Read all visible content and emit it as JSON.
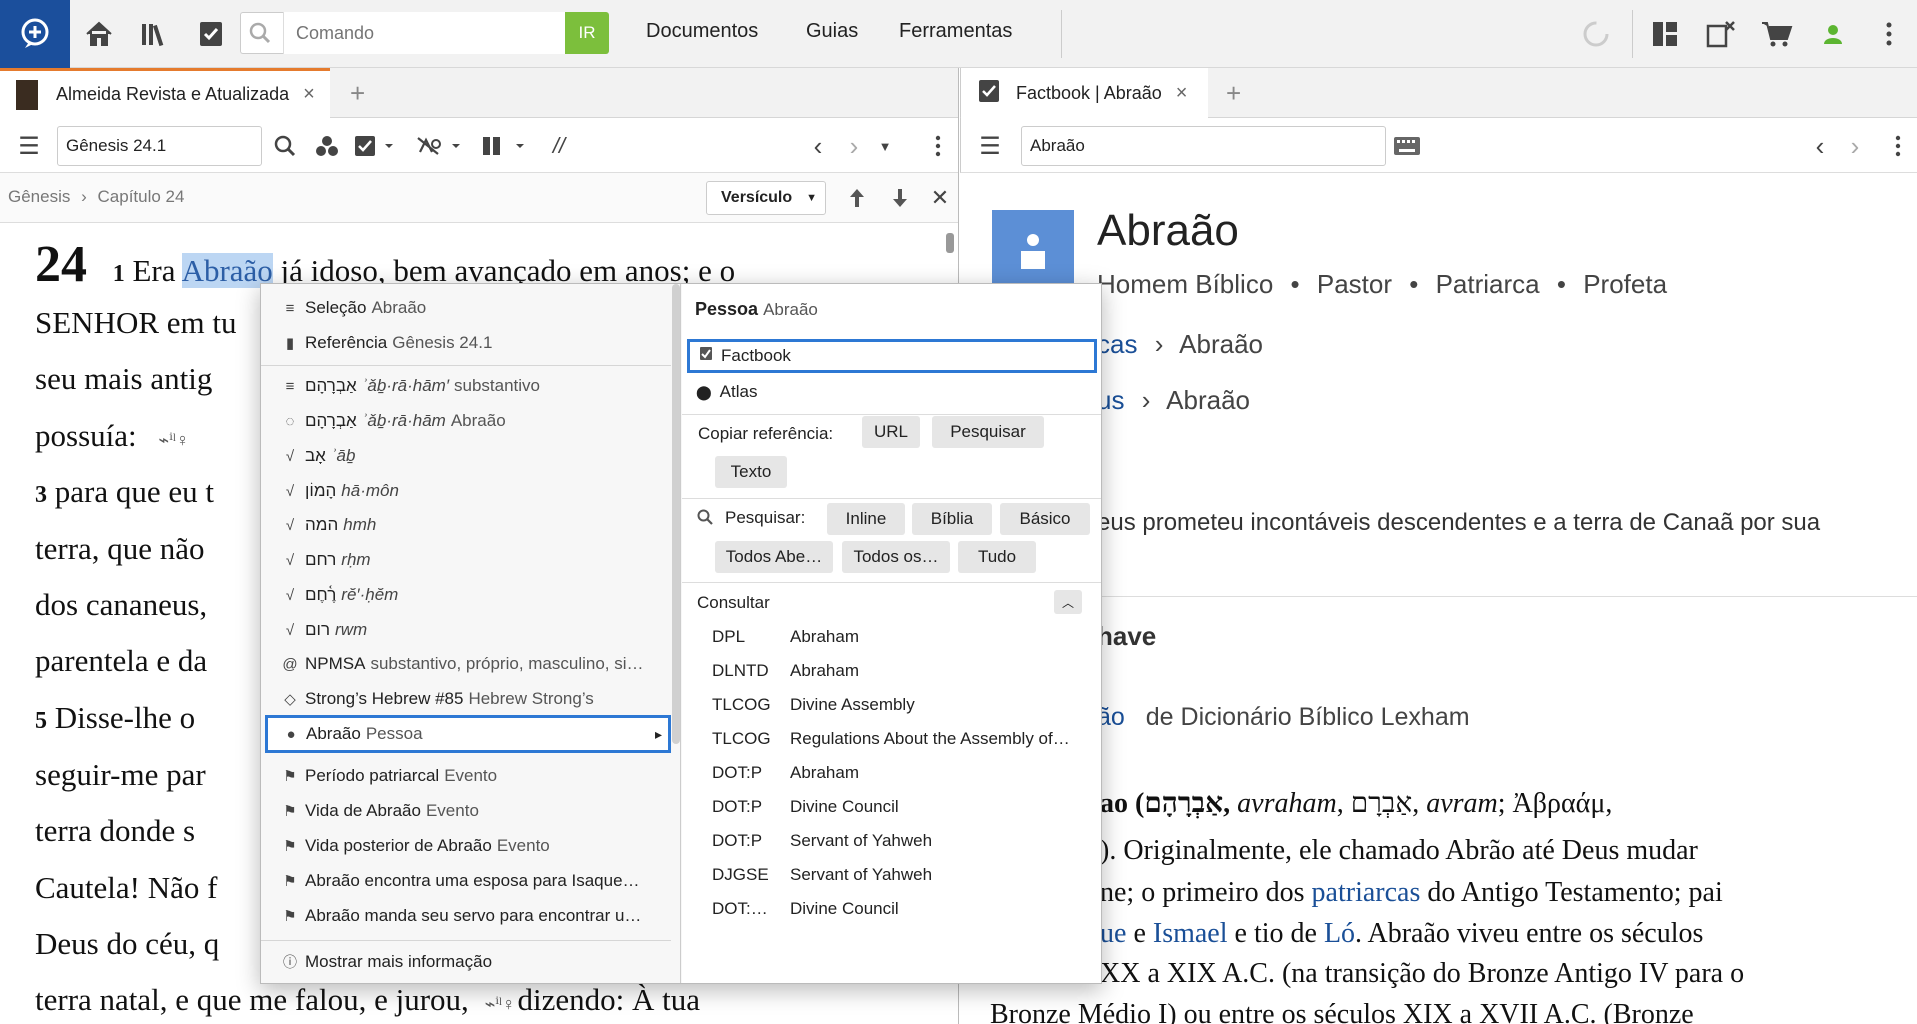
{
  "toolbar": {
    "command_placeholder": "Comando",
    "go_label": "IR",
    "menus": [
      "Documentos",
      "Guias",
      "Ferramentas"
    ]
  },
  "left_tab": {
    "title": "Almeida Revista e Atualizada",
    "close": "×",
    "add": "+"
  },
  "right_tab": {
    "title": "Factbook | Abraão",
    "close": "×",
    "add": "+"
  },
  "left_panel": {
    "reference": "Gênesis 24.1",
    "breadcrumb": [
      "Gênesis",
      "›",
      "Capítulo 24"
    ],
    "versiculo": "Versículo",
    "parallel": "//",
    "chapter": "24",
    "lines": [
      {
        "vnum": "1",
        "pre": " Era ",
        "hl": "Abraão",
        "post": " já idoso, bem avançado em anos; e o"
      },
      {
        "text": "SENHOR em tu"
      },
      {
        "text": "seu mais antig"
      },
      {
        "text": "possuía:"
      },
      {
        "vnum": "3",
        "text": " para que eu t"
      },
      {
        "text": "terra, que não"
      },
      {
        "text": "dos cananeus,"
      },
      {
        "text": "parentela e da"
      },
      {
        "vnum": "5",
        "text": " Disse-lhe o"
      },
      {
        "text": "seguir-me par"
      },
      {
        "text": "terra donde s"
      },
      {
        "text": "Cautela! Não f"
      },
      {
        "text": "Deus do céu, q"
      },
      {
        "text": "terra natal, e que me falou, e jurou,",
        "post": "dizendo: À tua"
      }
    ]
  },
  "right_panel": {
    "search": "Abraão",
    "title": "Abraão",
    "roles": [
      "Homem Bíblico",
      "•",
      "Pastor",
      "•",
      "Patriarca",
      "•",
      "Profeta"
    ],
    "crumb1": {
      "link": "cas",
      "sep": "›",
      "name": "Abraão"
    },
    "crumb2": {
      "link": "us",
      "sep": "›",
      "name": "Abraão"
    },
    "summary": "eus prometeu incontáveis descendentes e a terra de Canaã por sua",
    "section": "have",
    "dict_link": "ão",
    "dict_source": "de Dicionário Bíblico Lexham",
    "article": {
      "l1_heb": "ao (אַבְרָהָם, ",
      "l1_rest1": "avraham",
      "l1_mid": ", אַבְרָם, ",
      "l1_rest2": "avram",
      "l1_end": "; Ἀβραάμ,",
      "l2": "). Originalmente, ele chamado Abrão até Deus mudar",
      "l3_pre": "ne; o primeiro dos ",
      "l3_link": "patriarcas",
      "l3_post": " do Antigo Testamento; pai",
      "l4_link1": "ue",
      "l4_mid": " e ",
      "l4_link2": "Ismael",
      "l4_mid2": " e tio de ",
      "l4_link3": "Ló",
      "l4_post": ". Abraão viveu entre os séculos",
      "l5": "XX a XIX A.C. (na transição do Bronze Antigo IV para o",
      "l6": "Bronze Médio I) ou entre os séculos XIX a XVII A.C. (Bronze"
    }
  },
  "context_menu": {
    "items": [
      {
        "icon": "≡",
        "label": "Seleção",
        "muted": "Abraão"
      },
      {
        "icon": "▮",
        "label": "Referência",
        "muted": "Gênesis 24.1"
      },
      {
        "icon": "≡",
        "label": "אַבְרָהָם",
        "it": "ʾǎḇ·rā·hām′",
        "muted": "substantivo"
      },
      {
        "icon": "◌",
        "label": "אַבְרָהָם",
        "it": "ʾǎḇ·rā·hām",
        "muted": "Abraão"
      },
      {
        "icon": "√",
        "label": "אָב",
        "it": "ʾāḇ"
      },
      {
        "icon": "√",
        "label": "הָמוֹן",
        "it": "hā·môn"
      },
      {
        "icon": "√",
        "label": "המה",
        "it": "hmh"
      },
      {
        "icon": "√",
        "label": "רחם",
        "it": "rḥm"
      },
      {
        "icon": "√",
        "label": "רֶ֫חֶם",
        "it": "rĕ′·ḥĕm"
      },
      {
        "icon": "√",
        "label": "רום",
        "it": "rwm"
      },
      {
        "icon": "@",
        "label": "NPMSA",
        "muted": "substantivo, próprio, masculino, si…"
      },
      {
        "icon": "◇",
        "label": "Strong’s Hebrew #85",
        "muted": "Hebrew Strong’s"
      },
      {
        "icon": "●",
        "label": "Abraão",
        "muted": "Pessoa",
        "arrow": "▸"
      },
      {
        "icon": "⚑",
        "label": "Período patriarcal",
        "muted": "Evento"
      },
      {
        "icon": "⚑",
        "label": "Vida de Abraão",
        "muted": "Evento"
      },
      {
        "icon": "⚑",
        "label": "Vida posterior de Abraão",
        "muted": "Evento"
      },
      {
        "icon": "⚑",
        "label": "Abraão encontra uma esposa para Isaque…"
      },
      {
        "icon": "⚑",
        "label": "Abraão manda seu servo para encontrar u…"
      }
    ],
    "more_info": "Mostrar mais informação",
    "sub": {
      "header_bold": "Pessoa",
      "header_name": "Abraão",
      "factbook": "Factbook",
      "atlas": "Atlas",
      "copy_label": "Copiar referência:",
      "copy_buttons": [
        "URL",
        "Pesquisar",
        "Texto"
      ],
      "search_label": "Pesquisar:",
      "search_buttons": [
        "Inline",
        "Bíblia",
        "Básico",
        "Todos Abe…",
        "Todos os…",
        "Tudo"
      ],
      "consult_label": "Consultar",
      "consult": [
        {
          "abbr": "DPL",
          "title": "Abraham"
        },
        {
          "abbr": "DLNTD",
          "title": "Abraham"
        },
        {
          "abbr": "TLCOG",
          "title": "Divine Assembly"
        },
        {
          "abbr": "TLCOG",
          "title": "Regulations About the Assembly of…"
        },
        {
          "abbr": "DOT:P",
          "title": "Abraham"
        },
        {
          "abbr": "DOT:P",
          "title": "Divine Council"
        },
        {
          "abbr": "DOT:P",
          "title": "Servant of Yahweh"
        },
        {
          "abbr": "DJGSE",
          "title": "Servant of Yahweh"
        },
        {
          "abbr": "DOT:…",
          "title": "Divine Council"
        }
      ]
    }
  },
  "colors": {
    "accent": "#2d78d4",
    "go": "#7cbf3c",
    "logo": "#1b4f9c",
    "person": "#5c8fd6",
    "highlight": "#bcd6f3"
  }
}
